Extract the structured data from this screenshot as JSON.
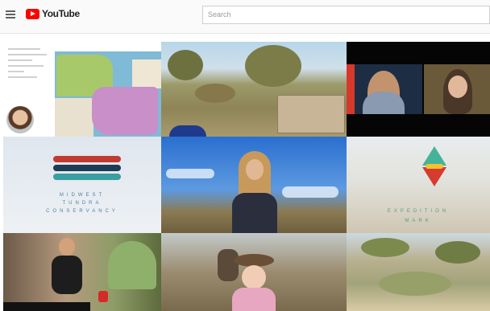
{
  "header": {
    "logo_text": "YouTube",
    "search_placeholder": "Search"
  },
  "brand": {
    "accent": "#ff0000"
  },
  "tiles": [
    {
      "name": "map-screenshare-tile",
      "caption": ""
    },
    {
      "name": "desert-landscape-tile",
      "caption": ""
    },
    {
      "name": "video-call-tile",
      "caption": ""
    },
    {
      "name": "midwest-tundra-logo-tile",
      "caption_line1": "MIDWEST",
      "caption_line2": "TUNDRA",
      "caption_line3": "CONSERVANCY"
    },
    {
      "name": "presenter-tile",
      "caption": ""
    },
    {
      "name": "expedition-logo-tile",
      "caption_line1": "EXPEDITION",
      "caption_line2": "MARK"
    },
    {
      "name": "yoga-tile",
      "caption": ""
    },
    {
      "name": "field-interview-tile",
      "caption": ""
    },
    {
      "name": "hillside-tile",
      "caption": ""
    }
  ]
}
